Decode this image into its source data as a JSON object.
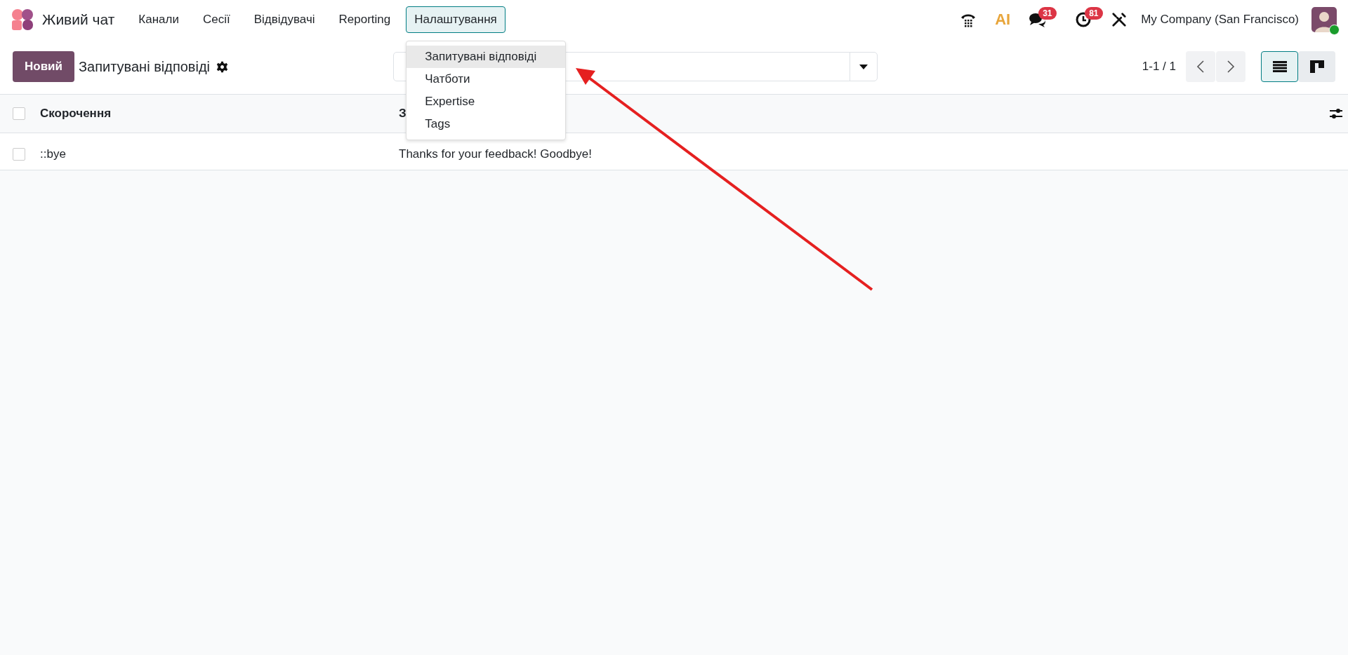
{
  "app": {
    "name": "Живий чат"
  },
  "menu": [
    {
      "label": "Канали",
      "selected": false
    },
    {
      "label": "Сесії",
      "selected": false
    },
    {
      "label": "Відвідувачі",
      "selected": false
    },
    {
      "label": "Reporting",
      "selected": false
    },
    {
      "label": "Налаштування",
      "selected": true
    }
  ],
  "dropdown": {
    "items": [
      {
        "label": "Запитувані відповіді",
        "selected": true
      },
      {
        "label": "Чатботи",
        "selected": false
      },
      {
        "label": "Expertise",
        "selected": false
      },
      {
        "label": "Tags",
        "selected": false
      }
    ]
  },
  "systray": {
    "ai_label": "AI",
    "chat_badge": "31",
    "activity_badge": "81",
    "company": "My Company (San Francisco)"
  },
  "control": {
    "new_button": "Новий",
    "title": "Запитувані відповіді",
    "pager": "1-1 / 1"
  },
  "views": [
    {
      "kind": "list",
      "selected": true
    },
    {
      "kind": "kanban",
      "selected": false
    }
  ],
  "table": {
    "all_checked": false,
    "columns": [
      "Скорочення",
      "З"
    ],
    "rows": [
      {
        "checked": false,
        "cells": [
          "::bye",
          "Thanks for your feedback! Goodbye!"
        ]
      }
    ]
  }
}
